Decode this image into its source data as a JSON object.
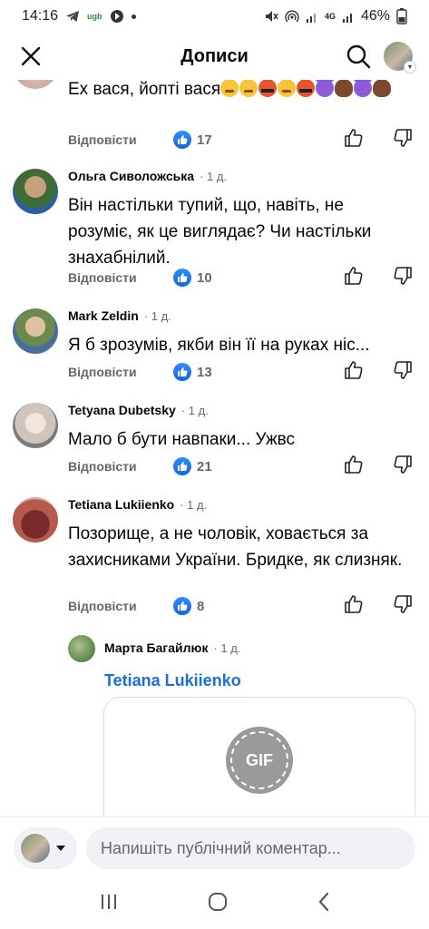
{
  "status_bar": {
    "time": "14:16",
    "carrier_badge": "ugb",
    "network": "4G",
    "battery": "46%"
  },
  "header": {
    "title": "Дописи",
    "close_icon": "close-icon",
    "search_icon": "search-icon"
  },
  "comments": [
    {
      "name": "",
      "time": "",
      "text": "Ех вася, йопті вася",
      "emojis": [
        "tired",
        "tired",
        "angry",
        "tired",
        "angry",
        "devil",
        "poop",
        "devil",
        "poop"
      ],
      "reply_label": "Відповісти",
      "likes": "17"
    },
    {
      "name": "Ольга Сиволожська",
      "time": "1 д.",
      "text": "Він настільки тупий,  що, навіть,  не розуміє,  як це виглядає? Чи настільки знахабнілий.",
      "reply_label": "Відповісти",
      "likes": "10"
    },
    {
      "name": "Mark Zeldin",
      "time": "1 д.",
      "text": "Я б зрозумів, якби він її на руках ніс...",
      "reply_label": "Відповісти",
      "likes": "13"
    },
    {
      "name": "Tetyana Dubetsky",
      "time": "1 д.",
      "text": "Мало б бути навпаки... Ужвс",
      "reply_label": "Відповісти",
      "likes": "21"
    },
    {
      "name": "Tetiana Lukiienko",
      "time": "1 д.",
      "text": "Позорище, а не чоловік, ховається за захисниками України. Бридке, як слизняк.",
      "reply_label": "Відповісти",
      "likes": "8"
    }
  ],
  "reply": {
    "name": "Марта Багайлюк",
    "time": "1 д.",
    "mention": "Tetiana Lukiienko",
    "gif_label": "GIF"
  },
  "composer": {
    "placeholder": "Напишіть публічний коментар..."
  },
  "colors": {
    "like_blue": "#1877f2",
    "mention_blue": "#1b6fd1",
    "secondary_text": "#65676b"
  }
}
